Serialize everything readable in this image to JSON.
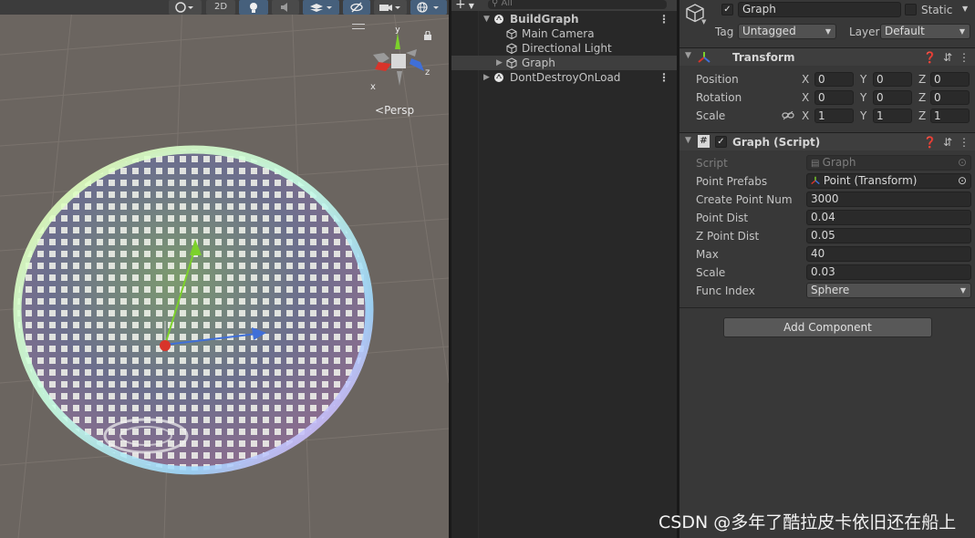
{
  "scene": {
    "toolbar": {
      "mode_2d": "2D"
    },
    "gizmo": {
      "axis_y": "y",
      "axis_x": "x",
      "axis_z": "z"
    },
    "projection": "Persp",
    "colors": {
      "axis_x": "#d8342a",
      "axis_y": "#7cd12b",
      "axis_z": "#3f6fd8",
      "background": "#6b6560"
    }
  },
  "hierarchy": {
    "search_placeholder": "All",
    "items": [
      {
        "label": "BuildGraph",
        "icon": "unity-scene-icon",
        "expanded": true,
        "depth": 0
      },
      {
        "label": "Main Camera",
        "icon": "gameobject-cube-icon",
        "depth": 1
      },
      {
        "label": "Directional Light",
        "icon": "gameobject-cube-icon",
        "depth": 1
      },
      {
        "label": "Graph",
        "icon": "gameobject-cube-icon",
        "depth": 1,
        "selected": true,
        "has_children": true
      },
      {
        "label": "DontDestroyOnLoad",
        "icon": "unity-scene-icon",
        "expanded": false,
        "depth": 0
      }
    ]
  },
  "inspector": {
    "object_name": "Graph",
    "static_label": "Static",
    "tag_label": "Tag",
    "tag_value": "Untagged",
    "layer_label": "Layer",
    "layer_value": "Default",
    "transform": {
      "title": "Transform",
      "position": {
        "label": "Position",
        "x": "0",
        "y": "0",
        "z": "0"
      },
      "rotation": {
        "label": "Rotation",
        "x": "0",
        "y": "0",
        "z": "0"
      },
      "scale": {
        "label": "Scale",
        "x": "1",
        "y": "1",
        "z": "1"
      },
      "axis_labels": {
        "x": "X",
        "y": "Y",
        "z": "Z"
      }
    },
    "graph_script": {
      "title": "Graph (Script)",
      "fields": [
        {
          "label": "Script",
          "value": "Graph",
          "kind": "script-ref"
        },
        {
          "label": "Point Prefabs",
          "value": "Point (Transform)",
          "kind": "object-ref"
        },
        {
          "label": "Create Point Num",
          "value": "3000",
          "kind": "text"
        },
        {
          "label": "Point Dist",
          "value": "0.04",
          "kind": "text"
        },
        {
          "label": "Z Point Dist",
          "value": "0.05",
          "kind": "text"
        },
        {
          "label": "Max",
          "value": "40",
          "kind": "text"
        },
        {
          "label": "Scale",
          "value": "0.03",
          "kind": "text"
        },
        {
          "label": "Func Index",
          "value": "Sphere",
          "kind": "dropdown"
        }
      ]
    },
    "add_component": "Add Component"
  },
  "watermark": "CSDN @多年了酷拉皮卡依旧还在船上"
}
